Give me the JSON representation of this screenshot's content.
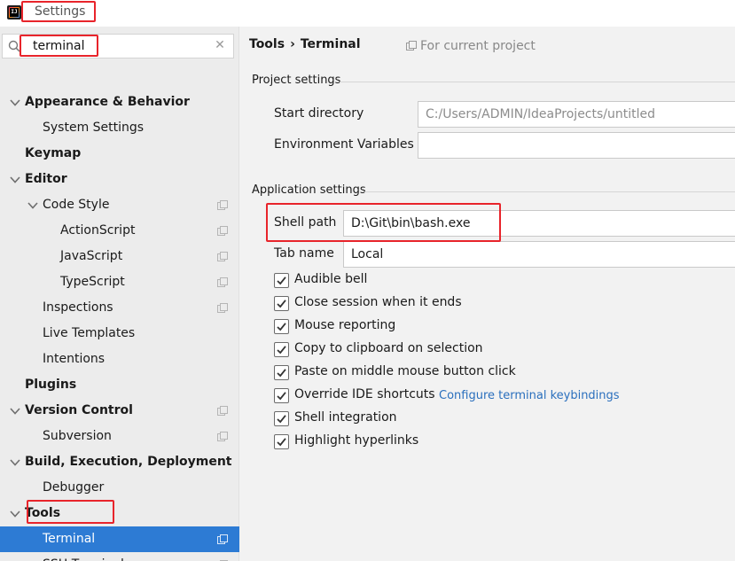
{
  "window": {
    "title": "Settings"
  },
  "sidebar": {
    "search": {
      "value": "terminal"
    },
    "items": [
      {
        "label": "Appearance & Behavior",
        "level": 0,
        "bold": true,
        "expanded": true,
        "copy": false
      },
      {
        "label": "System Settings",
        "level": 1,
        "bold": false,
        "copy": false
      },
      {
        "label": "Keymap",
        "level": 0,
        "bold": true,
        "copy": false
      },
      {
        "label": "Editor",
        "level": 0,
        "bold": true,
        "expanded": true,
        "copy": false
      },
      {
        "label": "Code Style",
        "level": 1,
        "bold": false,
        "expanded": true,
        "copy": true
      },
      {
        "label": "ActionScript",
        "level": 2,
        "bold": false,
        "copy": true
      },
      {
        "label": "JavaScript",
        "level": 2,
        "bold": false,
        "copy": true
      },
      {
        "label": "TypeScript",
        "level": 2,
        "bold": false,
        "copy": true
      },
      {
        "label": "Inspections",
        "level": 1,
        "bold": false,
        "copy": true
      },
      {
        "label": "Live Templates",
        "level": 1,
        "bold": false,
        "copy": false
      },
      {
        "label": "Intentions",
        "level": 1,
        "bold": false,
        "copy": false
      },
      {
        "label": "Plugins",
        "level": 0,
        "bold": true,
        "copy": false
      },
      {
        "label": "Version Control",
        "level": 0,
        "bold": true,
        "expanded": true,
        "copy": true
      },
      {
        "label": "Subversion",
        "level": 1,
        "bold": false,
        "copy": true
      },
      {
        "label": "Build, Execution, Deployment",
        "level": 0,
        "bold": true,
        "expanded": true,
        "copy": false
      },
      {
        "label": "Debugger",
        "level": 1,
        "bold": false,
        "copy": false
      },
      {
        "label": "Tools",
        "level": 0,
        "bold": true,
        "expanded": true,
        "copy": false
      },
      {
        "label": "Terminal",
        "level": 1,
        "bold": false,
        "selected": true,
        "copy": true
      },
      {
        "label": "SSH Terminal",
        "level": 1,
        "bold": false,
        "copy": true
      }
    ]
  },
  "main": {
    "breadcrumb": {
      "parent": "Tools",
      "separator": "›",
      "current": "Terminal"
    },
    "scope_label": "For current project",
    "project_settings": {
      "title": "Project settings",
      "start_directory_label": "Start directory",
      "start_directory_value": "C:/Users/ADMIN/IdeaProjects/untitled",
      "env_vars_label": "Environment Variables",
      "env_vars_value": ""
    },
    "application_settings": {
      "title": "Application settings",
      "shell_path_label": "Shell path",
      "shell_path_value": "D:\\Git\\bin\\bash.exe",
      "tab_name_label": "Tab name",
      "tab_name_value": "Local",
      "checkboxes": [
        {
          "label": "Audible bell",
          "checked": true
        },
        {
          "label": "Close session when it ends",
          "checked": true
        },
        {
          "label": "Mouse reporting",
          "checked": true
        },
        {
          "label": "Copy to clipboard on selection",
          "checked": true
        },
        {
          "label": "Paste on middle mouse button click",
          "checked": true
        },
        {
          "label": "Override IDE shortcuts",
          "checked": true
        },
        {
          "label": "Shell integration",
          "checked": true
        },
        {
          "label": "Highlight hyperlinks",
          "checked": true
        }
      ],
      "keybindings_link": "Configure terminal keybindings"
    }
  },
  "colors": {
    "selection": "#2d7bd4",
    "highlight_box": "#e8242b",
    "link": "#2a6fbd"
  }
}
